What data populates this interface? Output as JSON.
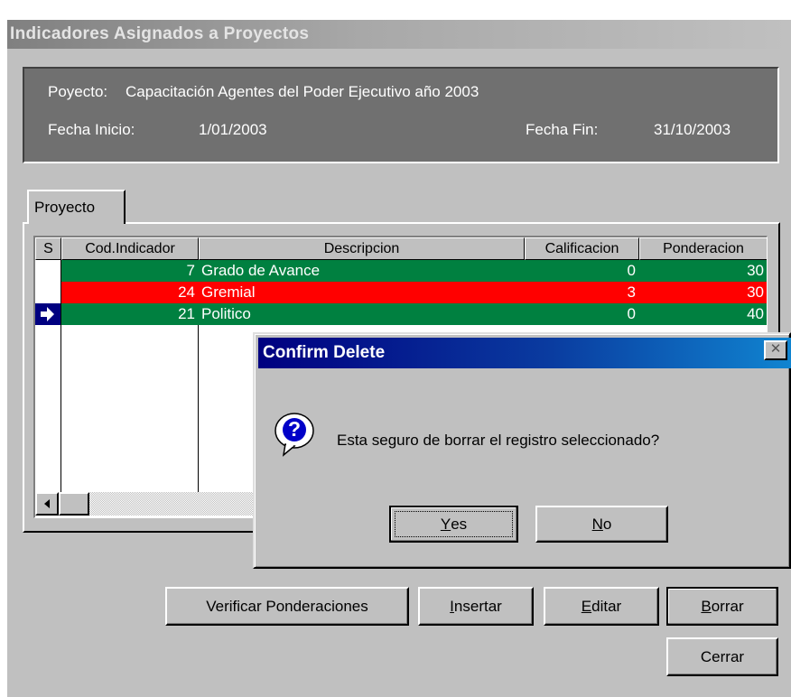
{
  "window": {
    "title": "Indicadores Asignados a Proyectos"
  },
  "info": {
    "project_label": "Poyecto:",
    "project_name": "Capacitación Agentes del Poder Ejecutivo año 2003",
    "start_label": "Fecha Inicio:",
    "start_date": "1/01/2003",
    "end_label": "Fecha Fin:",
    "end_date": "31/10/2003"
  },
  "tabs": [
    {
      "label": "Proyecto"
    }
  ],
  "grid": {
    "columns": [
      "S",
      "Cod.Indicador",
      "Descripcion",
      "Calificacion",
      "Ponderacion"
    ],
    "rows": [
      {
        "selected": false,
        "code": "7",
        "description": "Grado de Avance",
        "calificacion": "0",
        "ponderacion": "30",
        "color": "#008040"
      },
      {
        "selected": false,
        "code": "24",
        "description": "Gremial",
        "calificacion": "3",
        "ponderacion": "30",
        "color": "#ff0000"
      },
      {
        "selected": true,
        "code": "21",
        "description": "Politico",
        "calificacion": "0",
        "ponderacion": "40",
        "color": "#008040"
      }
    ]
  },
  "buttons": {
    "verificar": "Verificar Ponderaciones",
    "insertar_u": "I",
    "insertar_rest": "nsertar",
    "editar_u": "E",
    "editar_rest": "ditar",
    "borrar_u": "B",
    "borrar_rest": "orrar",
    "cerrar": "Cerrar"
  },
  "dialog": {
    "title": "Confirm Delete",
    "message": "Esta seguro de borrar el registro seleccionado?",
    "yes_u": "Y",
    "yes_rest": "es",
    "no_u": "N",
    "no_rest": "o",
    "close_glyph": "✕",
    "icon_glyph": "?"
  },
  "colors": {
    "green_row": "#008040",
    "red_row": "#ff0000",
    "dialog_title": "#000080",
    "panel": "#707070"
  }
}
